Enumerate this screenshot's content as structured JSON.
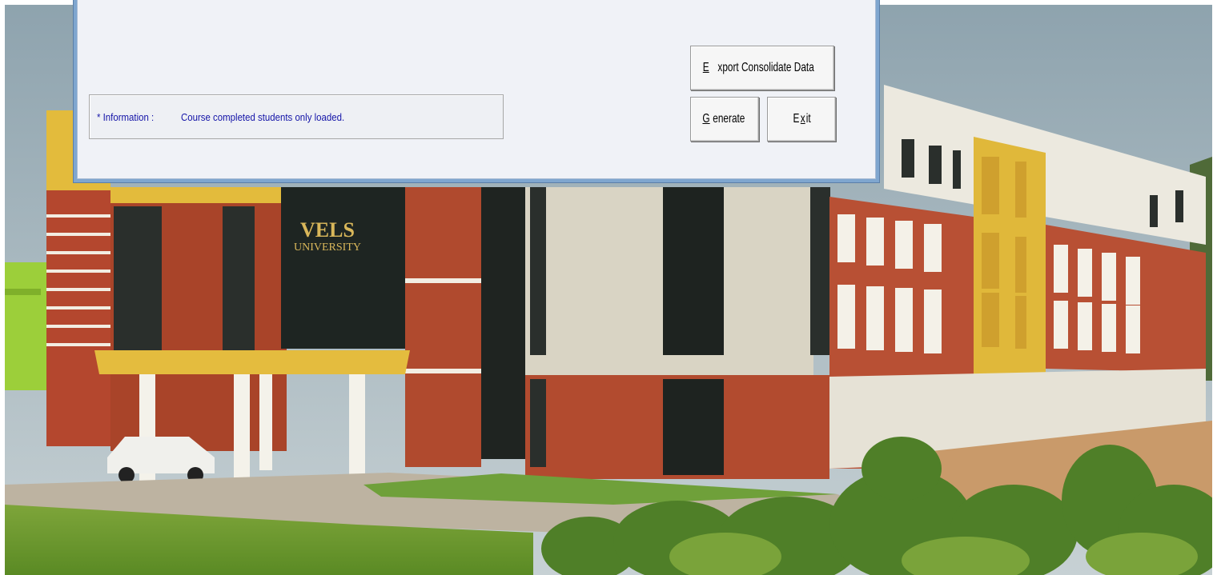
{
  "dialog": {
    "info_label": "* Information :",
    "info_text": "Course completed students only loaded."
  },
  "buttons": {
    "export": {
      "mnemonic": "E",
      "rest": "xport Consolidate Data"
    },
    "generate": {
      "mnemonic": "G",
      "rest": "enerate"
    },
    "exit": {
      "pre": "E",
      "mnemonic": "x",
      "rest": "it"
    }
  },
  "background": {
    "sign_line1": "VELS",
    "sign_line2": "UNIVERSITY"
  },
  "colors": {
    "dialog_frame": "#7fa6cf",
    "dialog_body": "#f0f2f7",
    "info_text": "#1414a8",
    "sky": "#aebfc9",
    "brick": "#b04a2e",
    "yellow_accent": "#e0b83a",
    "lawn": "#6f9a2c"
  }
}
